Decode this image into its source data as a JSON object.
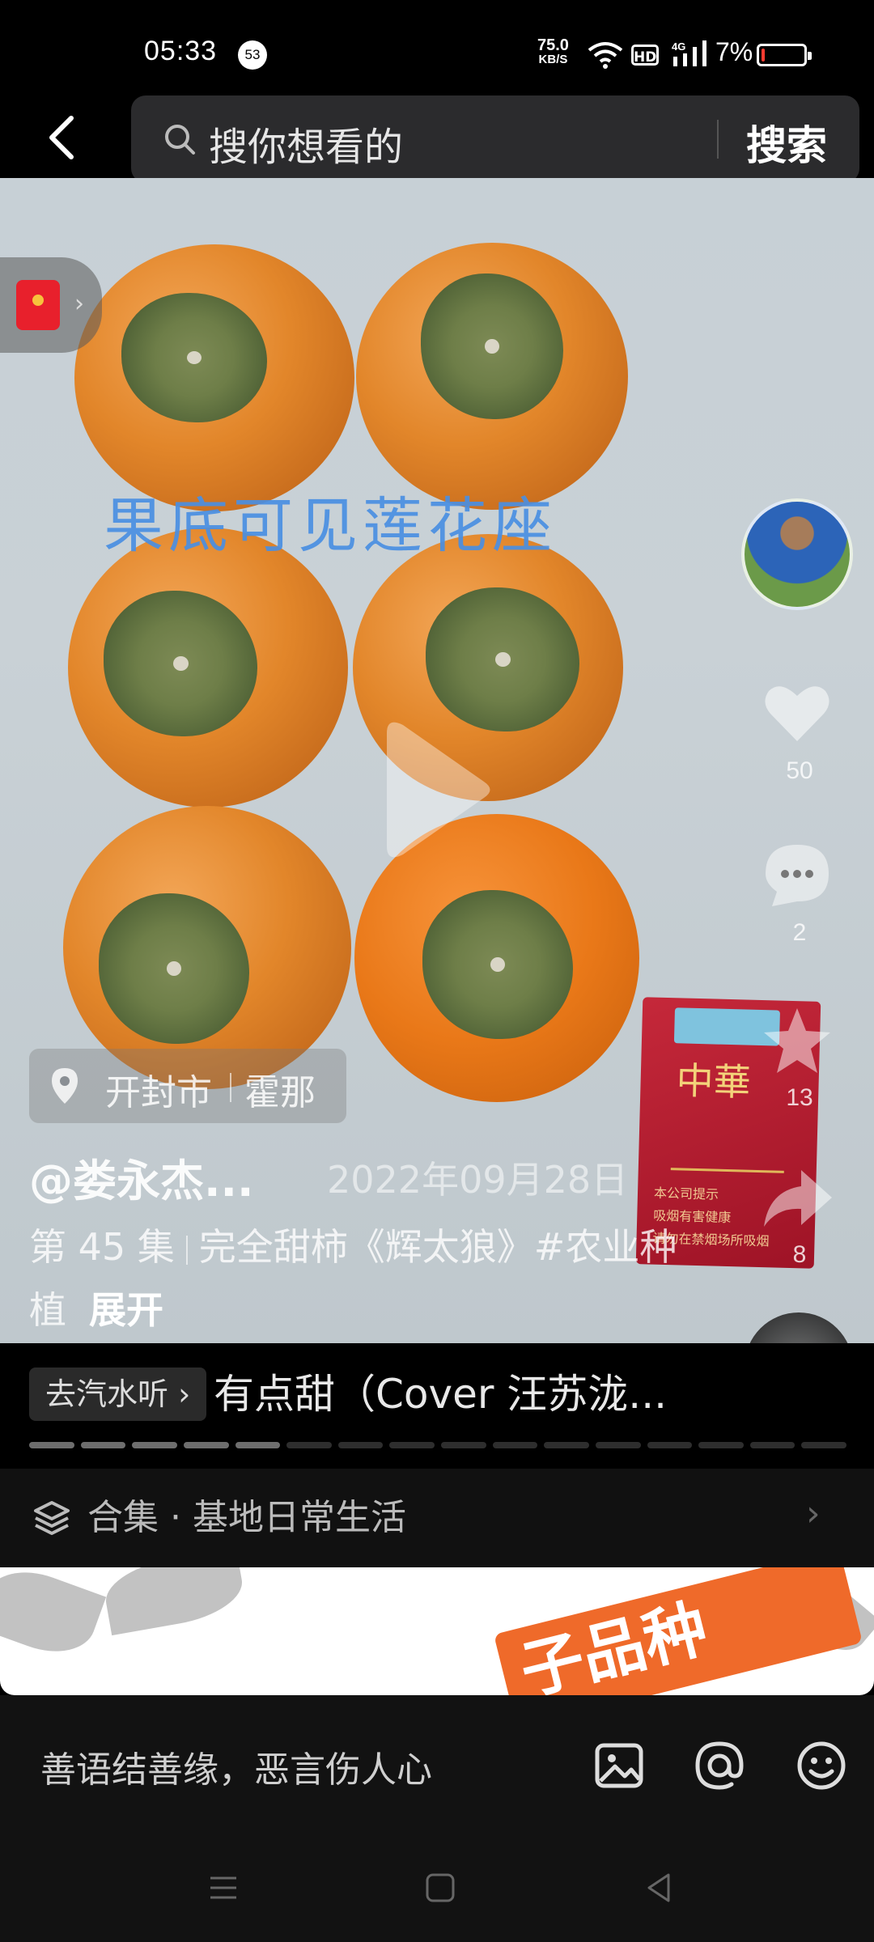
{
  "status_bar": {
    "time": "05:33",
    "notification_count": "53",
    "net_speed_value": "75.0",
    "net_speed_unit": "KB/S",
    "hd_label": "HD",
    "network_type": "4G",
    "battery_percent": "7%",
    "battery_level": 0.07,
    "battery_color": "#ff3b30"
  },
  "header": {
    "search_placeholder": "搜你想看的",
    "search_button": "搜索"
  },
  "video": {
    "overlay_caption": "果底可见莲花座",
    "cigarette_brand": "中華",
    "cigarette_lines": [
      "本公司提示",
      "吸烟有害健康",
      "请勿在禁烟场所吸烟"
    ]
  },
  "side_actions": {
    "like_count": "50",
    "comment_count": "2",
    "favorite_count": "13",
    "share_count": "8"
  },
  "post": {
    "location_city": "开封市",
    "location_area": "霍那",
    "author": "@娄永杰...",
    "date": "2022年09月28日",
    "episode": "第 45 集",
    "description": "完全甜柿《辉太狼》#农业种植",
    "expand_label": "展开"
  },
  "music": {
    "tag_label": "去汽水听",
    "song_title": "有点甜（Cover 汪苏泷..."
  },
  "progress": {
    "total_segments": 16,
    "completed_segments": 5
  },
  "collection": {
    "label": "合集 · 基地日常生活"
  },
  "banner": {
    "partial_text": "子品种"
  },
  "comment_bar": {
    "placeholder": "善语结善缘，恶言伤人心"
  },
  "colors": {
    "accent_red": "#e8202c",
    "caption_blue": "#4a8fe2",
    "banner_orange": "#ef6a2a"
  }
}
